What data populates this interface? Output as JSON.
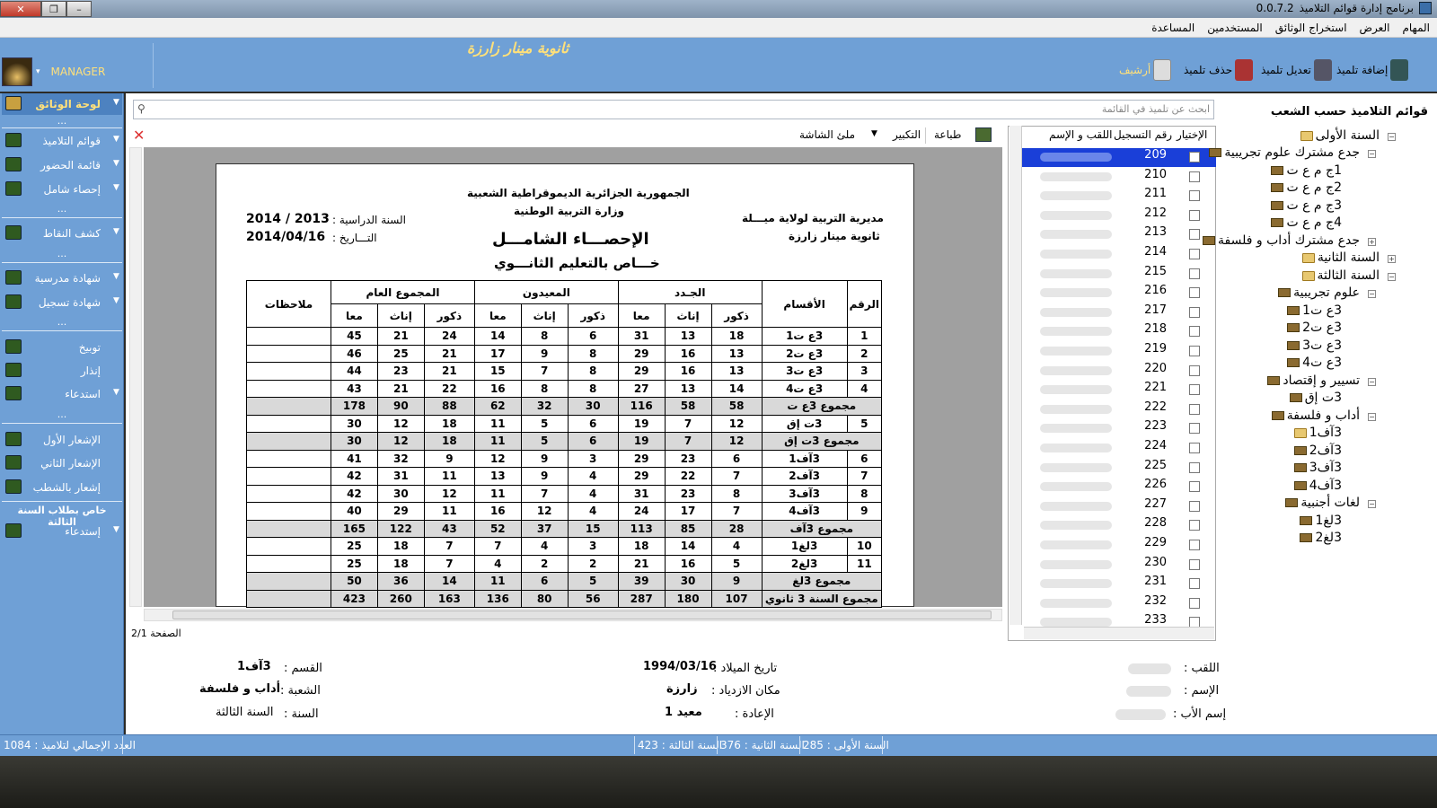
{
  "window": {
    "title": "برنامج إدارة قوائم التلاميذ",
    "version": "0.0.7.2"
  },
  "menu": [
    "المهام",
    "العرض",
    "استخراج الوثائق",
    "المستخدمين",
    "المساعدة"
  ],
  "header": {
    "school": "ثانوية مينار زارزة",
    "user": "MANAGER"
  },
  "toolbar": {
    "add": "إضافة تلميذ",
    "edit": "تعديل تلميذ",
    "delete": "حذف تلميذ",
    "archive": "أرشيف"
  },
  "sidebar": {
    "docs_title": "لوحة الوثائق",
    "dots": "...",
    "items": [
      "قوائم التلاميذ",
      "قائمة الحضور",
      "إحصاء شامل",
      "كشف النقاط",
      "شهادة مدرسية",
      "شهادة تسجيل",
      "توبيخ",
      "إنذار",
      "استدعاء",
      "الإشعار الأول",
      "الإشعار الثاني",
      "إشعار بالشطب"
    ],
    "section_third": "خاص بطلاب السنة الثالثة",
    "summon": "إستدعاء"
  },
  "search": {
    "placeholder": "ابحث عن تلميذ في القائمة"
  },
  "preview_toolbar": {
    "print": "طباعة",
    "zoom": "التكبير",
    "fit": "ملئ الشاشة"
  },
  "report": {
    "republic": "الجمهورية الجزائرية الديموقراطية الشعبية",
    "ministry": "وزارة التربية الوطنية",
    "directorate": "مديرية التربية لولاية ميـــلة",
    "school": "ثانوية مينار زارزة",
    "year_label": "السنة الدراسية :",
    "year_value": "2013 / 2014",
    "date_label": "التـــاريخ :",
    "date_value": "2014/04/16",
    "title": "الإحصـــاء الشامـــل",
    "subtitle": "خـــاص بالتعليم الثانـــوي",
    "headers": {
      "num": "الرقم",
      "section": "الأقسام",
      "new": "الجـدد",
      "repeat": "المعيدون",
      "total": "المجموع العام",
      "notes": "ملاحظات",
      "male": "ذكور",
      "female": "إناث",
      "both": "معا"
    },
    "rows": [
      {
        "n": "1",
        "s": "3ع ت1",
        "v": [
          "18",
          "13",
          "31",
          "6",
          "8",
          "14",
          "24",
          "21",
          "45"
        ],
        "t": false
      },
      {
        "n": "2",
        "s": "3ع ت2",
        "v": [
          "13",
          "16",
          "29",
          "8",
          "9",
          "17",
          "21",
          "25",
          "46"
        ],
        "t": false
      },
      {
        "n": "3",
        "s": "3ع ت3",
        "v": [
          "13",
          "16",
          "29",
          "8",
          "7",
          "15",
          "21",
          "23",
          "44"
        ],
        "t": false
      },
      {
        "n": "4",
        "s": "3ع ت4",
        "v": [
          "14",
          "13",
          "27",
          "8",
          "8",
          "16",
          "22",
          "21",
          "43"
        ],
        "t": false
      },
      {
        "n": "",
        "s": "مجموع 3ع ت",
        "v": [
          "58",
          "58",
          "116",
          "30",
          "32",
          "62",
          "88",
          "90",
          "178"
        ],
        "t": true
      },
      {
        "n": "5",
        "s": "3ت إق",
        "v": [
          "12",
          "7",
          "19",
          "6",
          "5",
          "11",
          "18",
          "12",
          "30"
        ],
        "t": false
      },
      {
        "n": "",
        "s": "مجموع 3ت إق",
        "v": [
          "12",
          "7",
          "19",
          "6",
          "5",
          "11",
          "18",
          "12",
          "30"
        ],
        "t": true
      },
      {
        "n": "6",
        "s": "3آف1",
        "v": [
          "6",
          "23",
          "29",
          "3",
          "9",
          "12",
          "9",
          "32",
          "41"
        ],
        "t": false
      },
      {
        "n": "7",
        "s": "3آف2",
        "v": [
          "7",
          "22",
          "29",
          "4",
          "9",
          "13",
          "11",
          "31",
          "42"
        ],
        "t": false
      },
      {
        "n": "8",
        "s": "3آف3",
        "v": [
          "8",
          "23",
          "31",
          "4",
          "7",
          "11",
          "12",
          "30",
          "42"
        ],
        "t": false
      },
      {
        "n": "9",
        "s": "3آف4",
        "v": [
          "7",
          "17",
          "24",
          "4",
          "12",
          "16",
          "11",
          "29",
          "40"
        ],
        "t": false
      },
      {
        "n": "",
        "s": "مجموع 3آف",
        "v": [
          "28",
          "85",
          "113",
          "15",
          "37",
          "52",
          "43",
          "122",
          "165"
        ],
        "t": true
      },
      {
        "n": "10",
        "s": "3لغ1",
        "v": [
          "4",
          "14",
          "18",
          "3",
          "4",
          "7",
          "7",
          "18",
          "25"
        ],
        "t": false
      },
      {
        "n": "11",
        "s": "3لغ2",
        "v": [
          "5",
          "16",
          "21",
          "2",
          "2",
          "4",
          "7",
          "18",
          "25"
        ],
        "t": false
      },
      {
        "n": "",
        "s": "مجموع 3لغ",
        "v": [
          "9",
          "30",
          "39",
          "5",
          "6",
          "11",
          "14",
          "36",
          "50"
        ],
        "t": true
      },
      {
        "n": "",
        "s": "مجموع السنة 3 ثانوي",
        "v": [
          "107",
          "180",
          "287",
          "56",
          "80",
          "136",
          "163",
          "260",
          "423"
        ],
        "t": true
      }
    ]
  },
  "page_indicator": "الصفحة 2/1",
  "grid": {
    "headers": {
      "choose": "الإختيار",
      "reg": "رقم التسجيل",
      "name": "اللقب و الإسم"
    },
    "rows": [
      "209",
      "210",
      "211",
      "212",
      "213",
      "214",
      "215",
      "216",
      "217",
      "218",
      "219",
      "220",
      "221",
      "222",
      "223",
      "224",
      "225",
      "226",
      "227",
      "228",
      "229",
      "230",
      "231",
      "232",
      "233"
    ]
  },
  "tree": {
    "title": "قوائم التلاميذ حسب الشعب",
    "nodes": [
      "السنة الأولى",
      "جدع مشترك علوم تجريبية",
      "1ج م ع ت",
      "2ج م ع ت",
      "3ج م ع ت",
      "4ج م ع ت",
      "جدع مشترك أداب و فلسفة",
      "السنة الثانية",
      "السنة الثالثة",
      "علوم تجريبية",
      "3ع ت1",
      "3ع ت2",
      "3ع ت3",
      "3ع ت4",
      "تسيير و إقتصاد",
      "3ت إق",
      "أداب و فلسفة",
      "3آف1",
      "3آف2",
      "3آف3",
      "3آف4",
      "لغات أجنبية",
      "3لغ1",
      "3لغ2"
    ]
  },
  "details": {
    "surname_label": "اللقب :",
    "name_label": "الإسم :",
    "father_label": "إسم الأب :",
    "birth_label": "تاريخ الميلاد :",
    "birth_value": "1994/03/16",
    "place_label": "مكان الازدياد :",
    "place_value": "زارزة",
    "repeat_label": "الإعادة :",
    "repeat_value": "معيد 1",
    "class_label": "القسم :",
    "class_value": "3آف1",
    "branch_label": "الشعبة :",
    "branch_value": "أداب و فلسفة",
    "year_label": "السنة :",
    "year_value": "السنة الثالثة"
  },
  "status": {
    "first": "السنة الأولى : 285",
    "second": "السنة الثانية : 376",
    "third": "السنة الثالثة : 423",
    "total": "العدد الإجمالي لتلاميذ : 1084"
  }
}
